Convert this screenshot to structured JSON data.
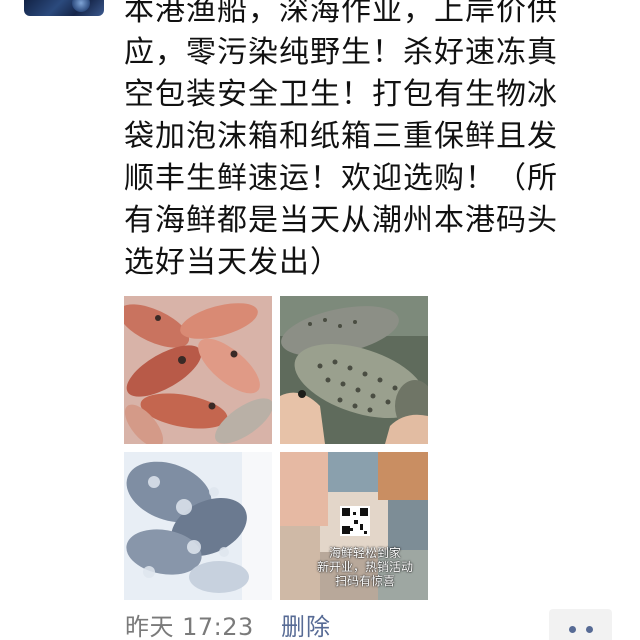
{
  "post": {
    "text_lines": [
      "本港渔船，深海作业，上岸价供",
      "应，零污染纯野生！杀好速冻真",
      "空包装安全卫生！打包有生物冰",
      "袋加泡沫箱和纸箱三重保鲜且发",
      "顺丰生鲜速运！欢迎选购！（所",
      "有海鲜都是当天从潮州本港码头",
      "选好当天发出）"
    ],
    "photos": [
      {
        "name": "photo-red-fish"
      },
      {
        "name": "photo-grouper-in-hand"
      },
      {
        "name": "photo-frozen-fish"
      },
      {
        "name": "photo-seafood-collage"
      }
    ],
    "collage_caption": [
      "海鲜轻松到家",
      "新开业，热销活动",
      "扫码有惊喜"
    ]
  },
  "footer": {
    "timestamp": "昨天 17:23",
    "delete_label": "删除"
  },
  "icons": {
    "more": "more-dots-icon"
  },
  "colors": {
    "link": "#576b95",
    "timestamp": "#7a7a7a",
    "text": "#111111"
  }
}
